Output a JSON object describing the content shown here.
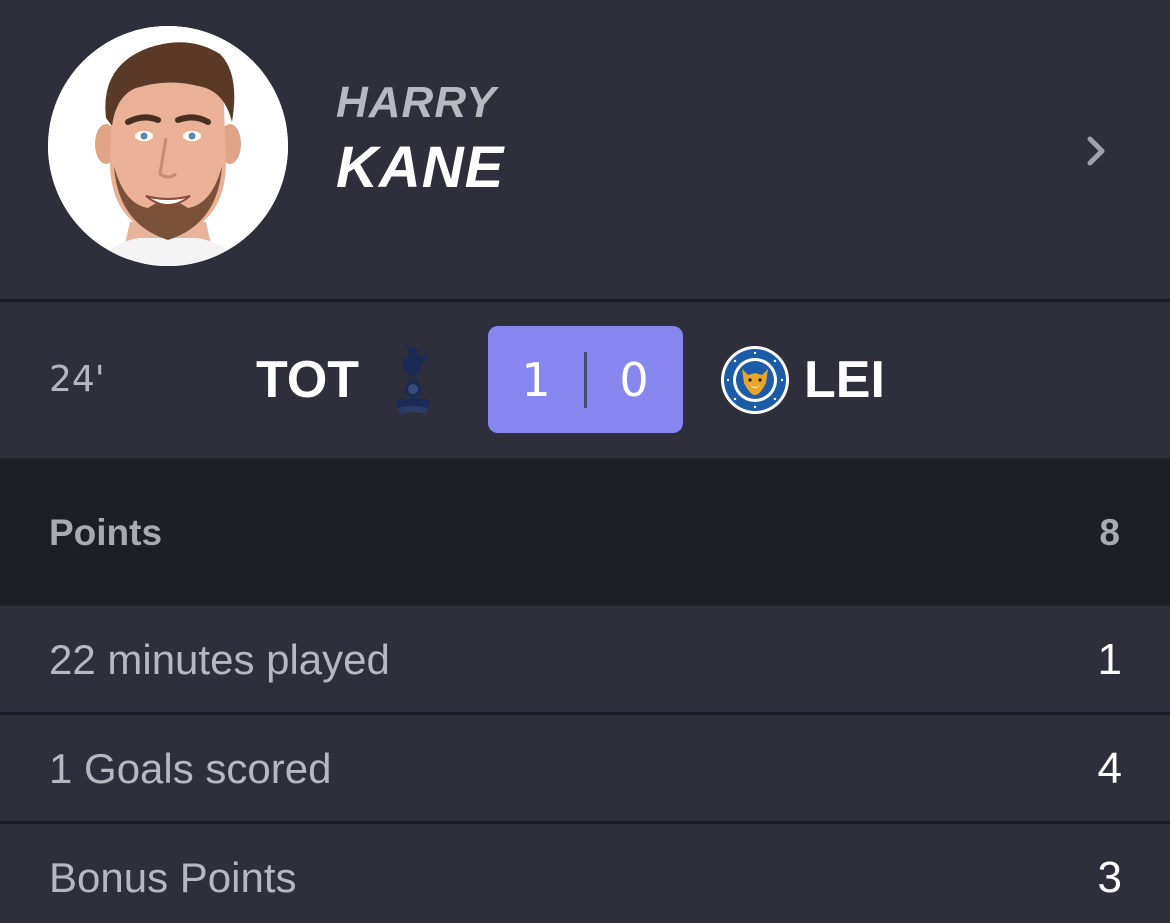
{
  "player": {
    "first_name": "HARRY",
    "last_name": "KANE",
    "avatar_icon": "player-avatar-icon",
    "chevron_icon": "chevron-right-icon"
  },
  "match": {
    "minute": "24'",
    "home_team": "TOT",
    "home_crest_icon": "tottenham-crest-icon",
    "home_score": "1",
    "away_score": "0",
    "away_team": "LEI",
    "away_crest_icon": "leicester-crest-icon",
    "score_color": "#8686ee"
  },
  "points": {
    "label": "Points",
    "total": "8"
  },
  "breakdown": [
    {
      "label": "22 minutes played",
      "value": "1"
    },
    {
      "label": "1 Goals scored",
      "value": "4"
    },
    {
      "label": "Bonus Points",
      "value": "3"
    }
  ]
}
